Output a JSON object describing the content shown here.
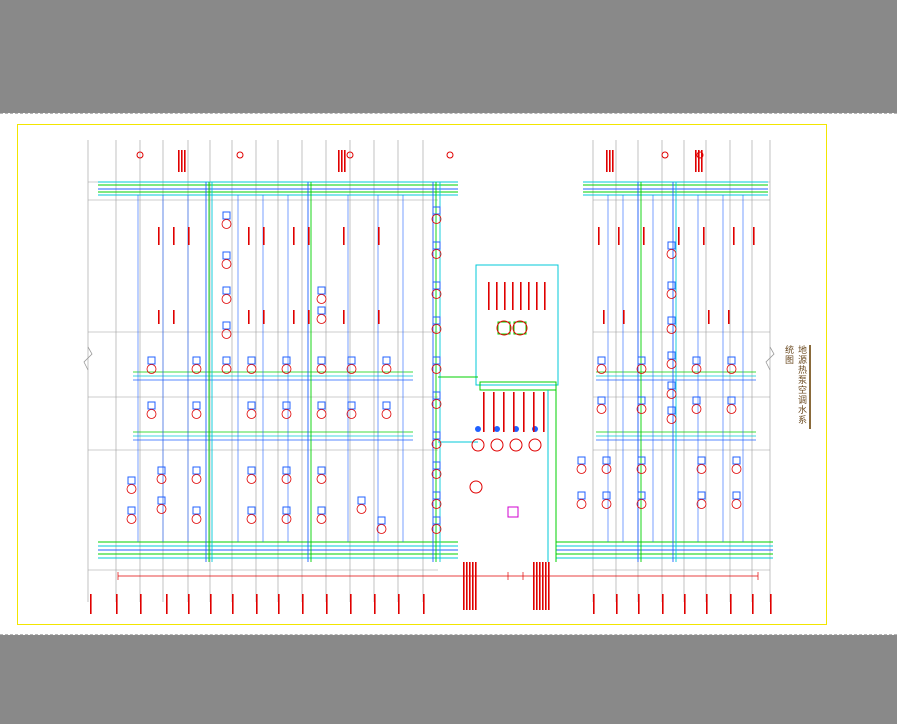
{
  "drawing": {
    "sheet_title": "地源热泵空调水系统图",
    "colors": {
      "frame": "#f2e600",
      "green_pipe": "#00d000",
      "blue_pipe": "#2060ff",
      "cyan_pipe": "#00c8d8",
      "red_annotation": "#e00000",
      "magenta": "#d000d0",
      "wall_gray": "#9a9a9a"
    }
  }
}
